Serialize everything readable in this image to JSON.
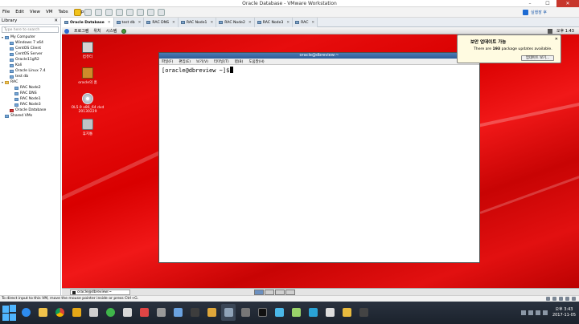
{
  "window": {
    "title": "Oracle Database - VMware Workstation"
  },
  "menu": [
    "File",
    "Edit",
    "View",
    "VM",
    "Tabs",
    "Help"
  ],
  "upsell": {
    "label": "실행장 후"
  },
  "library": {
    "title": "Library",
    "search_placeholder": "Type here to search",
    "tree": [
      {
        "label": "My Computer",
        "level": 0,
        "kind": "computer"
      },
      {
        "label": "Windows 7 x64",
        "level": 1,
        "kind": "vm"
      },
      {
        "label": "CentOS Client",
        "level": 1,
        "kind": "vm"
      },
      {
        "label": "CentOS Server",
        "level": 1,
        "kind": "vm"
      },
      {
        "label": "Oracle11gR2",
        "level": 1,
        "kind": "vm"
      },
      {
        "label": "Kali",
        "level": 1,
        "kind": "vm"
      },
      {
        "label": "Oracle Linux 7.4",
        "level": 1,
        "kind": "vm"
      },
      {
        "label": "test db",
        "level": 1,
        "kind": "vm"
      },
      {
        "label": "RAC",
        "level": 0,
        "kind": "folder"
      },
      {
        "label": "RAC Node2",
        "level": 2,
        "kind": "vm"
      },
      {
        "label": "RAC DNS",
        "level": 2,
        "kind": "vm"
      },
      {
        "label": "RAC Node1",
        "level": 2,
        "kind": "vm"
      },
      {
        "label": "RAC Node3",
        "level": 2,
        "kind": "vm"
      },
      {
        "label": "Oracle Database",
        "level": 1,
        "kind": "vm-red"
      },
      {
        "label": "Shared VMs",
        "level": 0,
        "kind": "vm"
      }
    ]
  },
  "tabs": [
    {
      "label": "Oracle Database",
      "active": true
    },
    {
      "label": "test db",
      "active": false
    },
    {
      "label": "RAC DNS",
      "active": false
    },
    {
      "label": "RAC Node1",
      "active": false
    },
    {
      "label": "RAC Node2",
      "active": false
    },
    {
      "label": "RAC Node3",
      "active": false
    },
    {
      "label": "RAC",
      "active": false
    }
  ],
  "guest": {
    "top_menu": [
      "프로그램",
      "위치",
      "시스템"
    ],
    "time": "오후 1:43",
    "desktop_icons": [
      {
        "name": "computer",
        "label": "컴퓨터"
      },
      {
        "name": "home",
        "label": "oracle의 홈"
      },
      {
        "name": "dvd",
        "label": "OL5.9 x86_64 dvd 20130229"
      },
      {
        "name": "trash",
        "label": "휴지통"
      }
    ],
    "terminal": {
      "title": "oracle@dbreview:~",
      "menu": [
        "파일(F)",
        "편집(E)",
        "보기(V)",
        "터미널(T)",
        "탭(B)",
        "도움말(H)"
      ],
      "prompt": "[oracle@dbreview ~]$"
    },
    "notification": {
      "title": "보안 업데이트 가능",
      "body_pre": "There are ",
      "count": "193",
      "body_post": " package updates available.",
      "button": "업데이트 보기..."
    },
    "taskbar_item": "oracle@dbreview:~"
  },
  "status": {
    "text": "To direct input to this VM, move the mouse pointer inside or press Ctrl+G."
  },
  "host_clock": {
    "time": "오후 3:43",
    "date": "2017-11-05"
  },
  "colors": {
    "vm_bg": "#d80000",
    "accent_blue": "#2e5d98"
  }
}
